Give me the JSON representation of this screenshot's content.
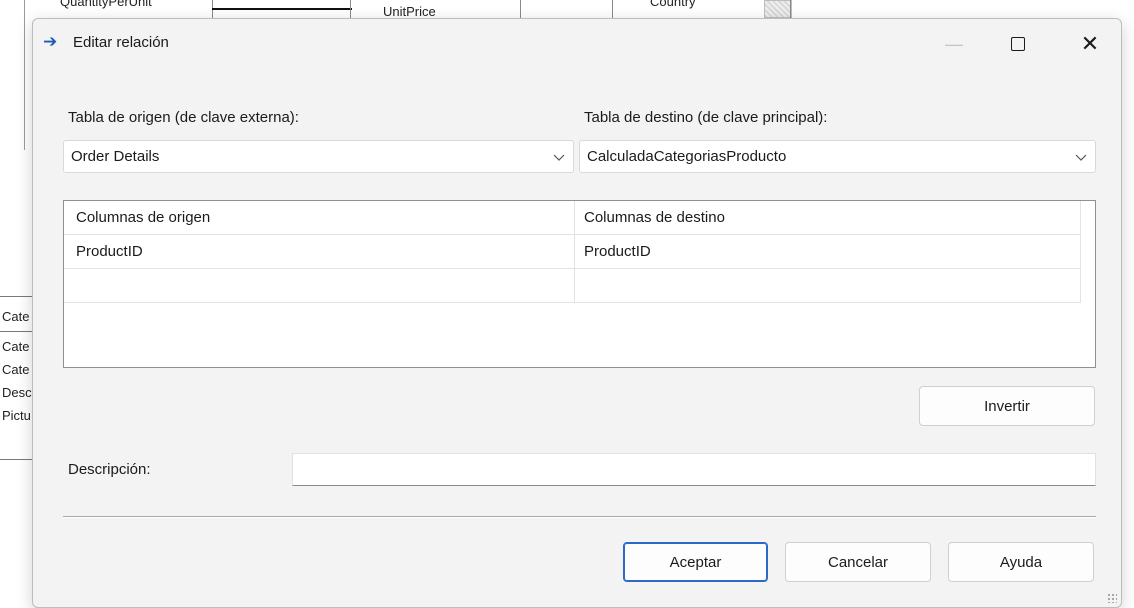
{
  "background": {
    "fields_top": [
      "QuantityPerUnit",
      "UnitPrice",
      "Country"
    ],
    "entity_rows": [
      "Cate",
      "Cate",
      "Cate",
      "Desc",
      "Pictu"
    ]
  },
  "dialog": {
    "title": "Editar relación",
    "title_icon": "arrow-right-icon",
    "window_buttons": {
      "minimize": "—",
      "maximize": "□",
      "close": "✕"
    },
    "source_table_label": "Tabla de origen (de clave externa):",
    "target_table_label": "Tabla de destino (de clave principal):",
    "source_table_value": "Order Details",
    "target_table_value": "CalculadaCategoriasProducto",
    "grid": {
      "headers": [
        "Columnas de origen",
        "Columnas de destino"
      ],
      "rows": [
        [
          "ProductID",
          "ProductID"
        ],
        [
          "",
          ""
        ]
      ]
    },
    "invert_button": "Invertir",
    "description_label": "Descripción:",
    "description_value": "",
    "ok_button": "Aceptar",
    "cancel_button": "Cancelar",
    "help_button": "Ayuda"
  },
  "colors": {
    "accent": "#2a68c9",
    "title_icon": "#1d5bb5",
    "dialog_bg": "#f3f3f3"
  }
}
